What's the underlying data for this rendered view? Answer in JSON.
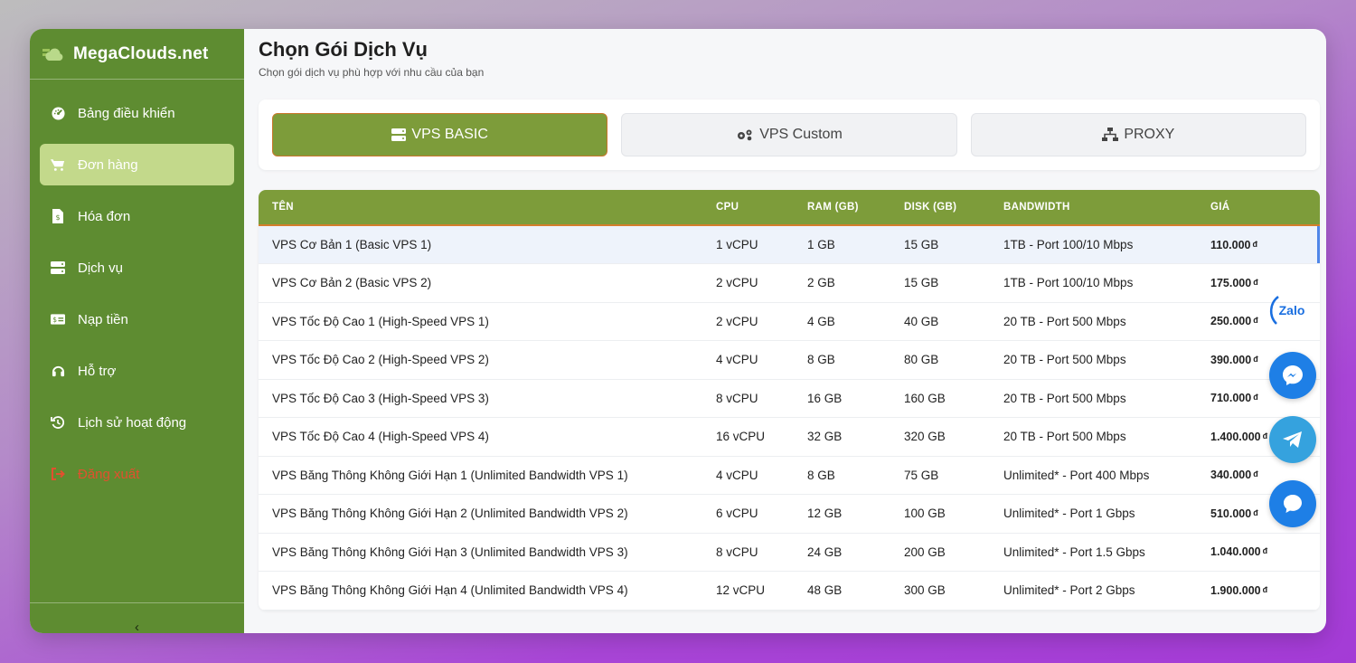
{
  "brand": {
    "title": "MegaClouds.net"
  },
  "sidebar": {
    "items": [
      {
        "label": "Bảng điều khiển",
        "icon": "dashboard-gauge-icon"
      },
      {
        "label": "Đơn hàng",
        "icon": "shopping-cart-icon",
        "active": true
      },
      {
        "label": "Hóa đơn",
        "icon": "invoice-file-icon"
      },
      {
        "label": "Dịch vụ",
        "icon": "server-icon"
      },
      {
        "label": "Nạp tiền",
        "icon": "money-bill-icon"
      },
      {
        "label": "Hỗ trợ",
        "icon": "headset-icon"
      },
      {
        "label": "Lịch sử hoạt động",
        "icon": "history-icon"
      },
      {
        "label": "Đăng xuất",
        "icon": "logout-icon"
      }
    ],
    "collapse_label": "‹"
  },
  "page": {
    "title": "Chọn Gói Dịch Vụ",
    "subtitle": "Chọn gói dịch vụ phù hợp với nhu cầu của bạn"
  },
  "tabs": [
    {
      "label": "VPS BASIC",
      "icon": "server-icon",
      "active": true
    },
    {
      "label": "VPS Custom",
      "icon": "cogs-icon"
    },
    {
      "label": "PROXY",
      "icon": "network-icon"
    }
  ],
  "table": {
    "headers": [
      "TÊN",
      "CPU",
      "RAM (GB)",
      "DISK (GB)",
      "BANDWIDTH",
      "GIÁ"
    ],
    "currency": "đ",
    "rows": [
      {
        "name": "VPS Cơ Bản 1 (Basic VPS 1)",
        "cpu": "1 vCPU",
        "ram": "1 GB",
        "disk": "15 GB",
        "bandwidth": "1TB - Port 100/10 Mbps",
        "price": "110.000"
      },
      {
        "name": "VPS Cơ Bản 2 (Basic VPS 2)",
        "cpu": "2 vCPU",
        "ram": "2 GB",
        "disk": "15 GB",
        "bandwidth": "1TB - Port 100/10 Mbps",
        "price": "175.000"
      },
      {
        "name": "VPS Tốc Độ Cao 1 (High-Speed VPS 1)",
        "cpu": "2 vCPU",
        "ram": "4 GB",
        "disk": "40 GB",
        "bandwidth": "20 TB - Port 500 Mbps",
        "price": "250.000"
      },
      {
        "name": "VPS Tốc Độ Cao 2 (High-Speed VPS 2)",
        "cpu": "4 vCPU",
        "ram": "8 GB",
        "disk": "80 GB",
        "bandwidth": "20 TB - Port 500 Mbps",
        "price": "390.000"
      },
      {
        "name": "VPS Tốc Độ Cao 3 (High-Speed VPS 3)",
        "cpu": "8 vCPU",
        "ram": "16 GB",
        "disk": "160 GB",
        "bandwidth": "20 TB - Port 500 Mbps",
        "price": "710.000"
      },
      {
        "name": "VPS Tốc Độ Cao 4 (High-Speed VPS 4)",
        "cpu": "16 vCPU",
        "ram": "32 GB",
        "disk": "320 GB",
        "bandwidth": "20 TB - Port 500 Mbps",
        "price": "1.400.000"
      },
      {
        "name": "VPS Băng Thông Không Giới Hạn 1 (Unlimited Bandwidth VPS 1)",
        "cpu": "4 vCPU",
        "ram": "8 GB",
        "disk": "75 GB",
        "bandwidth": "Unlimited* - Port 400 Mbps",
        "price": "340.000"
      },
      {
        "name": "VPS Băng Thông Không Giới Hạn 2 (Unlimited Bandwidth VPS 2)",
        "cpu": "6 vCPU",
        "ram": "12 GB",
        "disk": "100 GB",
        "bandwidth": "Unlimited* - Port 1 Gbps",
        "price": "510.000"
      },
      {
        "name": "VPS Băng Thông Không Giới Hạn 3 (Unlimited Bandwidth VPS 3)",
        "cpu": "8 vCPU",
        "ram": "24 GB",
        "disk": "200 GB",
        "bandwidth": "Unlimited* - Port 1.5 Gbps",
        "price": "1.040.000"
      },
      {
        "name": "VPS Băng Thông Không Giới Hạn 4 (Unlimited Bandwidth VPS 4)",
        "cpu": "12 vCPU",
        "ram": "48 GB",
        "disk": "300 GB",
        "bandwidth": "Unlimited* - Port 2 Gbps",
        "price": "1.900.000"
      }
    ]
  },
  "contact": {
    "zalo_label": "Zalo"
  },
  "colors": {
    "sidebar_bg": "#5e8c31",
    "accent_green": "#7d9c3a",
    "active_nav": "#c3d98b",
    "header_border": "#d47e2c",
    "logout_red": "#e2502e"
  }
}
